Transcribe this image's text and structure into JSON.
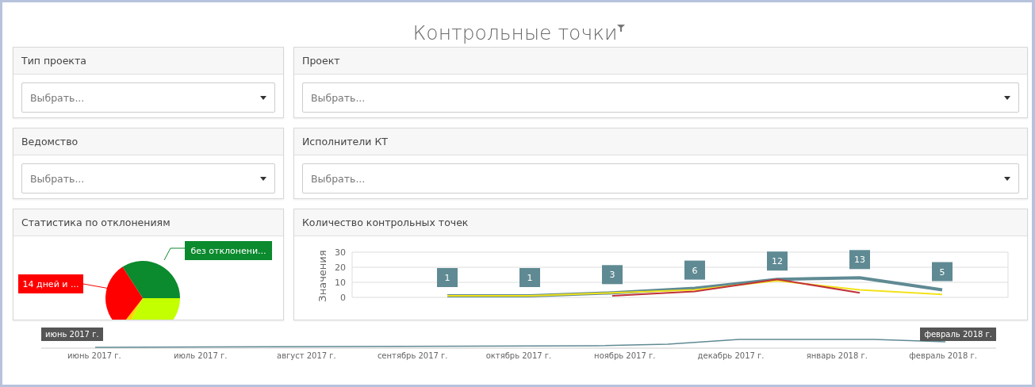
{
  "title": "Контрольные точки",
  "filters": [
    {
      "label": "Тип проекта",
      "placeholder": "Выбрать..."
    },
    {
      "label": "Проект",
      "placeholder": "Выбрать..."
    },
    {
      "label": "Ведомство",
      "placeholder": "Выбрать..."
    },
    {
      "label": "Исполнители КТ",
      "placeholder": "Выбрать..."
    }
  ],
  "deviation_panel": {
    "title": "Статистика по отклонениям",
    "labels": [
      {
        "text": "без отклонени...",
        "color": "#0b8a2e"
      },
      {
        "text": "14 дней и ...",
        "color": "#ff0000"
      }
    ]
  },
  "count_panel": {
    "title": "Количество контрольных точек",
    "point_labels": [
      "1",
      "1",
      "3",
      "6",
      "12",
      "13",
      "5"
    ],
    "chart_data": {
      "type": "line",
      "ylabel": "Значения",
      "ylim": [
        0,
        30
      ],
      "yticks": [
        0,
        10,
        20,
        30
      ],
      "series": [
        {
          "color": "#5f8a93",
          "values": [
            1,
            1,
            3,
            6,
            12,
            13,
            5
          ]
        },
        {
          "color": "#f2e21a",
          "values": [
            1,
            1,
            3,
            5,
            11,
            5,
            2
          ]
        },
        {
          "color": "#c0323a",
          "values": [
            null,
            null,
            1,
            4,
            12,
            3,
            null
          ]
        }
      ]
    }
  },
  "timeline": {
    "start_handle": "июнь 2017 г.",
    "end_handle": "февраль 2018 г.",
    "months": [
      "июнь 2017 г.",
      "июль 2017 г.",
      "август 2017 г.",
      "сентябрь 2017 г.",
      "октябрь 2017 г.",
      "ноябрь 2017 г.",
      "декабрь 2017 г.",
      "январь 2018 г.",
      "февраль 2018 г."
    ]
  }
}
